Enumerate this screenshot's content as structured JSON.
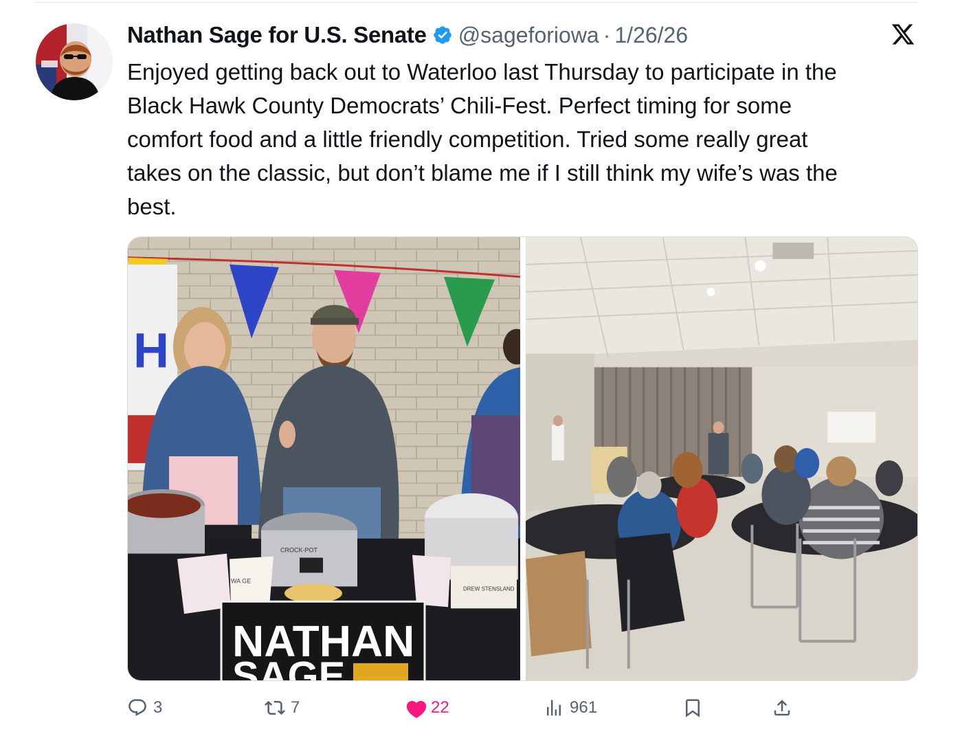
{
  "tweet": {
    "author_name": "Nathan Sage for U.S. Senate",
    "handle": "@sageforiowa",
    "separator": "·",
    "date": "1/26/26",
    "text": "Enjoyed getting back out to Waterloo last Thursday to participate in the\nBlack Hawk County Democrats’ Chili-Fest. Perfect timing for some\ncomfort food and a little friendly competition. Tried some really great\ntakes on the classic, but don’t blame me if I still think my wife’s was the\nbest.",
    "photos": [
      {
        "sign_line1": "NATHAN",
        "sign_line2": "SAGE",
        "table_card_label": "DREW STENSLAND",
        "crockpot_brand": "CROCK-POT",
        "cup_label": "WA  GE"
      },
      {}
    ]
  },
  "actions": {
    "reply_count": "3",
    "repost_count": "7",
    "like_count": "22",
    "views_count": "961"
  },
  "icons": {
    "verified": "verified-badge-icon",
    "platform": "x-logo-icon",
    "reply": "reply-icon",
    "repost": "repost-icon",
    "like": "heart-icon",
    "views": "views-icon",
    "bookmark": "bookmark-icon",
    "share": "share-icon"
  },
  "colors": {
    "text": "#0f1419",
    "secondary": "#536471",
    "verified": "#1d9bf0",
    "like": "#f91880"
  }
}
